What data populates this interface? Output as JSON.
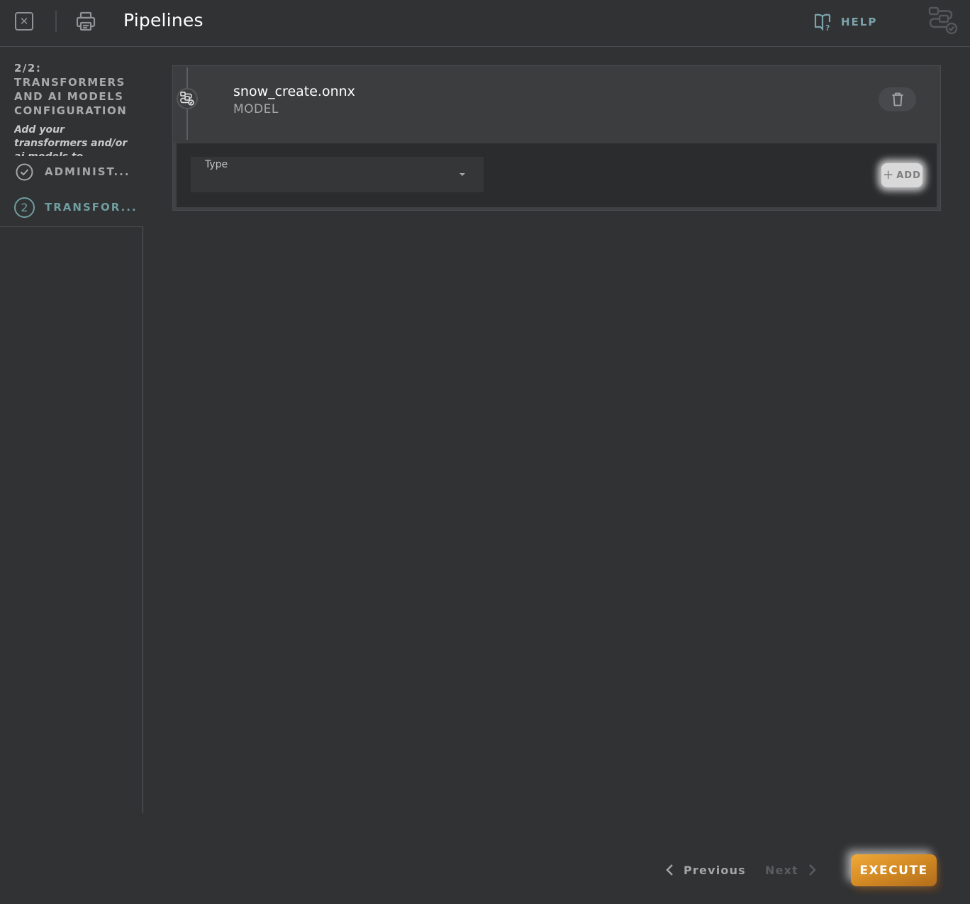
{
  "header": {
    "title": "Pipelines",
    "help_label": "HELP",
    "icons": {
      "close": "close-icon",
      "print": "printer-icon",
      "help": "book-question-icon",
      "pipeline": "pipeline-icon"
    }
  },
  "sidebar": {
    "step_counter": "2/2:",
    "step_title": "TRANSFORMERS AND AI MODELS CONFIGURATION",
    "step_description": "Add your transformers and/or ai models to...",
    "steps": [
      {
        "number": "1",
        "label": "ADMINIST...",
        "status": "completed",
        "icon": "check-circle-icon"
      },
      {
        "number": "2",
        "label": "TRANSFOR...",
        "status": "active"
      }
    ]
  },
  "pipeline_item": {
    "name": "snow_create.onnx",
    "kind": "MODEL",
    "node_icon": "pipeline-icon",
    "delete_icon": "trash-icon",
    "type_field": {
      "label": "Type",
      "value": ""
    },
    "add_label": "ADD"
  },
  "footer": {
    "previous_label": "Previous",
    "next_label": "Next",
    "execute_label": "EXECUTE"
  },
  "colors": {
    "background": "#313234",
    "accent_teal": "#6f9ea0",
    "execute_orange": "#e09a2e",
    "card": "#3c3d3f"
  }
}
